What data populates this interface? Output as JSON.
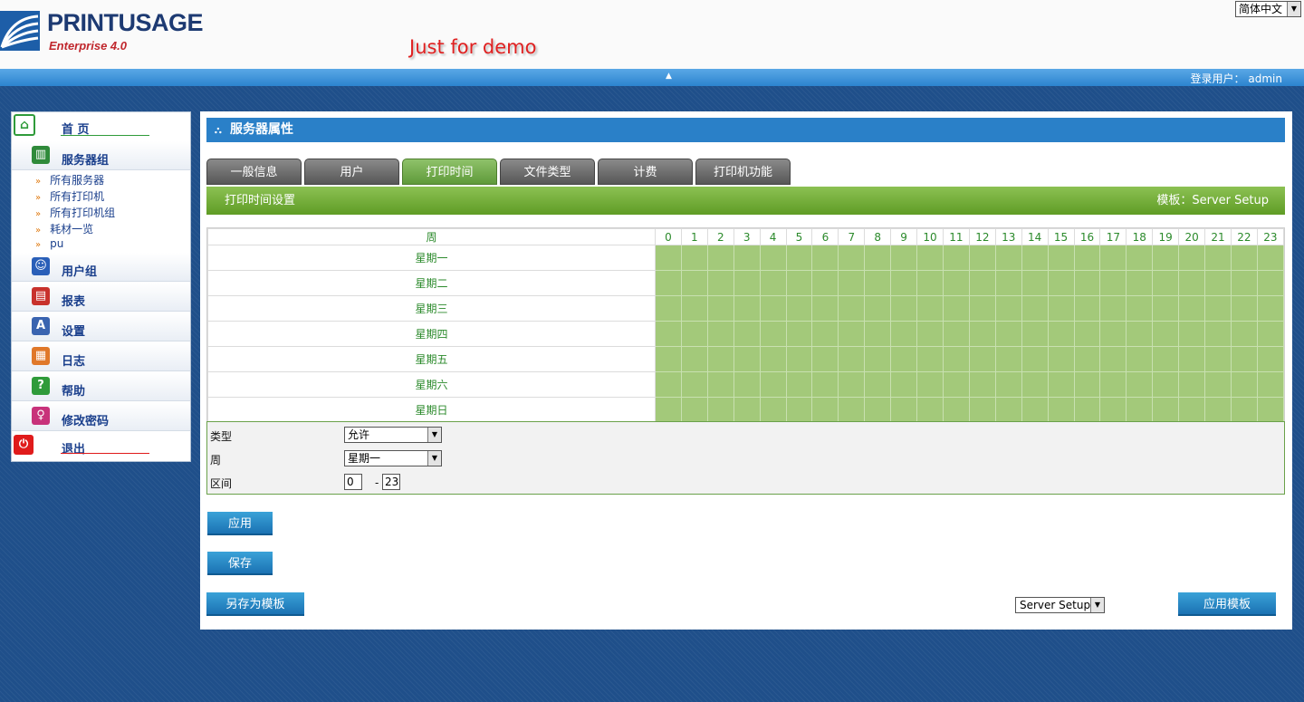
{
  "header": {
    "logo_text_print": "PRINT",
    "logo_text_usage": "USAGE",
    "logo_subtitle": "Enterprise 4.0",
    "demo_text": "Just for demo",
    "language": "简体中文",
    "login_label": "登录用户：",
    "login_user": "admin"
  },
  "sidebar": {
    "home": "首 页",
    "server_group": "服务器组",
    "sub_items": [
      "所有服务器",
      "所有打印机",
      "所有打印机组",
      "耗材一览",
      "pu"
    ],
    "user_group": "用户组",
    "reports": "报表",
    "settings": "设置",
    "logs": "日志",
    "help": "帮助",
    "change_password": "修改密码",
    "logout": "退出"
  },
  "panel": {
    "title": "服务器属性",
    "tabs": [
      "一般信息",
      "用户",
      "打印时间",
      "文件类型",
      "计费",
      "打印机功能"
    ],
    "active_tab": "打印时间",
    "section_title": "打印时间设置",
    "template_label": "模板：Server Setup"
  },
  "grid": {
    "week_header": "周",
    "hours": [
      "0",
      "1",
      "2",
      "3",
      "4",
      "5",
      "6",
      "7",
      "8",
      "9",
      "10",
      "11",
      "12",
      "13",
      "14",
      "15",
      "16",
      "17",
      "18",
      "19",
      "20",
      "21",
      "22",
      "23"
    ],
    "days": [
      "星期一",
      "星期二",
      "星期三",
      "星期四",
      "星期五",
      "星期六",
      "星期日"
    ],
    "allowed_color": "#a3c97a"
  },
  "form": {
    "type_label": "类型",
    "type_value": "允许",
    "week_label": "周",
    "week_value": "星期一",
    "range_label": "区间",
    "range_start": "0",
    "range_dash": "-",
    "range_end": "23"
  },
  "buttons": {
    "apply": "应用",
    "save": "保存",
    "save_as_template": "另存为模板",
    "template_select": "Server Setup",
    "apply_template": "应用模板"
  },
  "colors": {
    "accent_blue": "#2a80c8",
    "accent_green": "#6fae33",
    "demo_red": "#e02020"
  }
}
